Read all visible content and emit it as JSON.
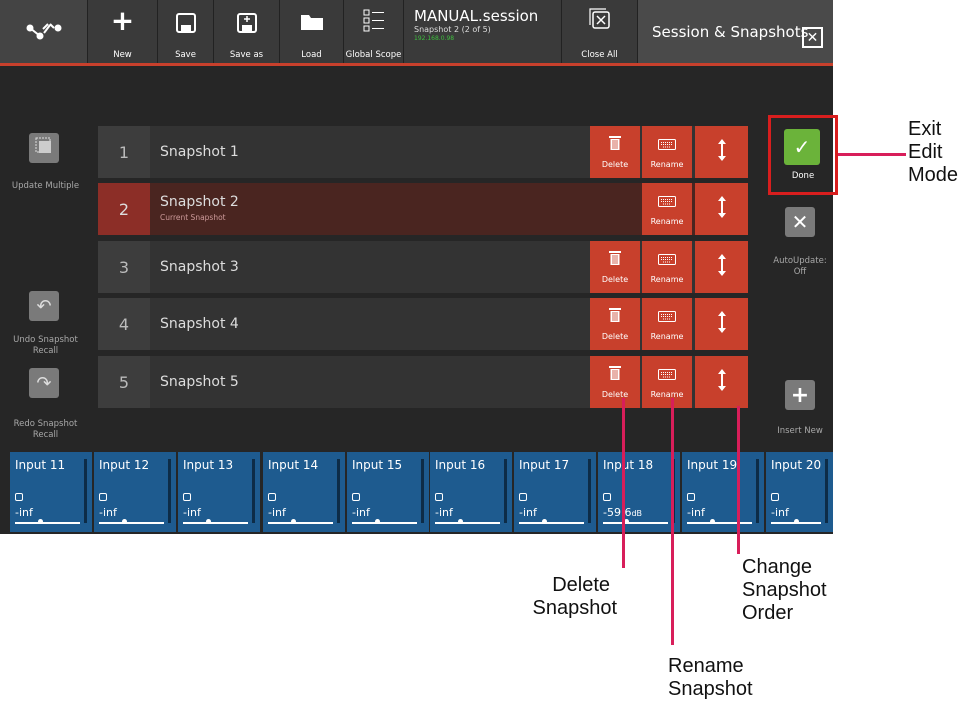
{
  "toolbar": {
    "new_label": "New",
    "save_label": "Save",
    "save_as_label": "Save as",
    "load_label": "Load",
    "global_scope_label": "Global Scope",
    "close_all_label": "Close All"
  },
  "session": {
    "name": "MANUAL.session",
    "snapshot_info": "Snapshot 2 (2 of 5)",
    "ip": "192.168.0.98"
  },
  "panel": {
    "title": "Session & Snapshots"
  },
  "left": {
    "update_multiple": "Update Multiple",
    "undo_recall": "Undo Snapshot Recall",
    "redo_recall": "Redo Snapshot Recall"
  },
  "right": {
    "done": "Done",
    "auto_update": "AutoUpdate: Off",
    "insert_new": "Insert New"
  },
  "snapshots": [
    {
      "num": "1",
      "name": "Snapshot 1",
      "delete": "Delete",
      "rename": "Rename"
    },
    {
      "num": "2",
      "name": "Snapshot 2",
      "sub": "Current Snapshot",
      "rename": "Rename"
    },
    {
      "num": "3",
      "name": "Snapshot 3",
      "delete": "Delete",
      "rename": "Rename"
    },
    {
      "num": "4",
      "name": "Snapshot 4",
      "delete": "Delete",
      "rename": "Rename"
    },
    {
      "num": "5",
      "name": "Snapshot 5",
      "delete": "Delete",
      "rename": "Rename"
    }
  ],
  "channels": [
    {
      "name": "Input 11",
      "value": "-inf"
    },
    {
      "name": "Input 12",
      "value": "-inf"
    },
    {
      "name": "Input 13",
      "value": "-inf"
    },
    {
      "name": "Input 14",
      "value": "-inf"
    },
    {
      "name": "Input 15",
      "value": "-inf"
    },
    {
      "name": "Input 16",
      "value": "-inf"
    },
    {
      "name": "Input 17",
      "value": "-inf"
    },
    {
      "name": "Input 18",
      "value": "-59.6",
      "unit": "dB"
    },
    {
      "name": "Input 19",
      "value": "-inf"
    },
    {
      "name": "Input 20",
      "value": "-inf"
    }
  ],
  "annotations": {
    "exit_edit_mode": [
      "Exit",
      "Edit",
      "Mode"
    ],
    "delete_snapshot": [
      "Delete",
      "Snapshot"
    ],
    "rename_snapshot": [
      "Rename",
      "Snapshot"
    ],
    "change_order": [
      "Change",
      "Snapshot",
      "Order"
    ]
  },
  "colors": {
    "accent": "#c8402c",
    "done_green": "#6bb33a",
    "channel_blue": "#1e5b8f",
    "callout": "#d81e5a"
  }
}
